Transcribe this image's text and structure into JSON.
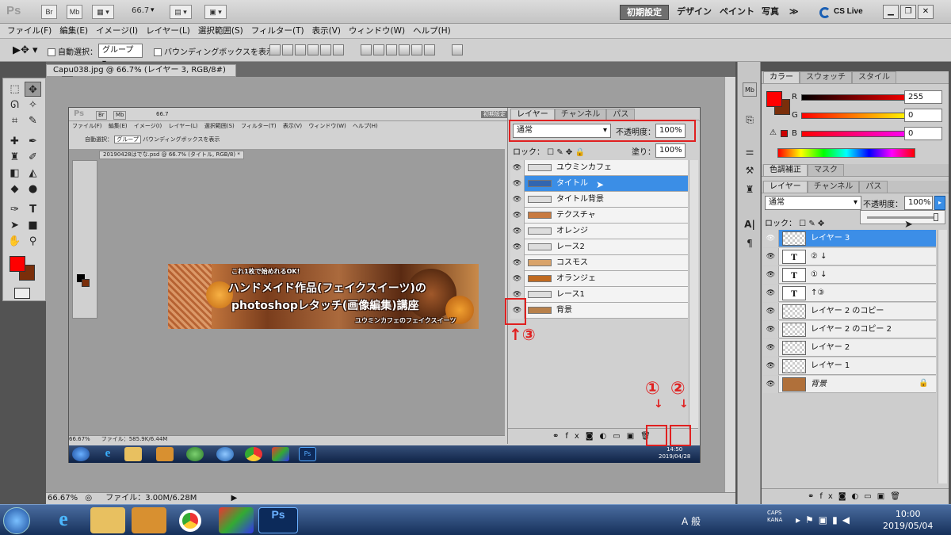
{
  "app": {
    "logo": "Ps",
    "br": "Br",
    "mb": "Mb",
    "zoom": "66.7",
    "workspaces": [
      "初期設定",
      "デザイン",
      "ペイント",
      "写真"
    ],
    "more": "≫",
    "cslive": "CS Live"
  },
  "menu": [
    "ファイル(F)",
    "編集(E)",
    "イメージ(I)",
    "レイヤー(L)",
    "選択範囲(S)",
    "フィルター(T)",
    "表示(V)",
    "ウィンドウ(W)",
    "ヘルプ(H)"
  ],
  "options": {
    "auto_select": "自動選択：",
    "auto_select_value": "グループ",
    "bounding_box": "バウンディングボックスを表示"
  },
  "doc": {
    "tab": "Capu038.jpg @ 66.7% (レイヤー 3, RGB/8#) *",
    "status_zoom": "66.67%",
    "status_file": "ファイル：3.00M/6.28M"
  },
  "inner": {
    "logo": "Ps",
    "br": "Br",
    "mb": "Mb",
    "zoom": "66.7",
    "workspace": "初期設定",
    "menu": [
      "ファイル(F)",
      "編集(E)",
      "イメージ(I)",
      "レイヤー(L)",
      "選択範囲(S)",
      "フィルター(T)",
      "表示(V)",
      "ウィンドウ(W)",
      "ヘルプ(H)"
    ],
    "auto_select": "自動選択：",
    "auto_select_value": "グループ",
    "bounding_box": "バウンディングボックスを表示",
    "doc_tab": "20190428はでな.psd @ 66.7% (タイトル, RGB/8) *",
    "status_zoom": "66.67%",
    "status_file": "ファイル：585.9K/6.44M",
    "clock_time": "14:50",
    "clock_date": "2019/04/28",
    "banner": {
      "line1": "これ1枚で始めれるOK!",
      "line2": "ハンドメイド作品(フェイクスイーツ)の",
      "line3": "photoshopレタッチ(画像編集)講座",
      "line4": "ユウミンカフェのフェイクスイーツ"
    },
    "panel": {
      "tabs": [
        "レイヤー",
        "チャンネル",
        "パス"
      ],
      "blend": "通常",
      "opacity_label": "不透明度：",
      "opacity": "100%",
      "lock_label": "ロック：",
      "fill_label": "塗り：",
      "fill": "100%",
      "layers": [
        {
          "name": "ユウミンカフェ"
        },
        {
          "name": "タイトル"
        },
        {
          "name": "タイトル背景"
        },
        {
          "name": "テクスチャ"
        },
        {
          "name": "オレンジ"
        },
        {
          "name": "レース2"
        },
        {
          "name": "コスモス"
        },
        {
          "name": "オランジェ"
        },
        {
          "name": "レース1"
        },
        {
          "name": "背景"
        }
      ]
    }
  },
  "annotations": {
    "a1": "①",
    "a2": "②",
    "a3": "↑③"
  },
  "color_panel": {
    "tabs": [
      "カラー",
      "スウォッチ",
      "スタイル"
    ],
    "r_label": "R",
    "g_label": "G",
    "b_label": "B",
    "r": "255",
    "g": "0",
    "b": "0",
    "fg": "#ff0000",
    "bg": "#7a2e0a"
  },
  "adjust_tabs": [
    "色調補正",
    "マスク"
  ],
  "layers_panel": {
    "tabs": [
      "レイヤー",
      "チャンネル",
      "パス"
    ],
    "blend": "通常",
    "opacity_label": "不透明度：",
    "opacity": "100%",
    "lock_label": "ロック：",
    "layers": [
      {
        "name": "レイヤー 3"
      },
      {
        "name": "② ↓",
        "glyph": "T"
      },
      {
        "name": "① ↓",
        "glyph": "T"
      },
      {
        "name": "↑③",
        "glyph": "T"
      },
      {
        "name": "レイヤー 2 のコピー"
      },
      {
        "name": "レイヤー 2 のコピー 2"
      },
      {
        "name": "レイヤー 2"
      },
      {
        "name": "レイヤー 1"
      },
      {
        "name": "背景"
      }
    ]
  },
  "system": {
    "time": "10:00",
    "date": "2019/05/04",
    "ime": "A 般",
    "caps": "CAPS",
    "kana": "KANA"
  }
}
